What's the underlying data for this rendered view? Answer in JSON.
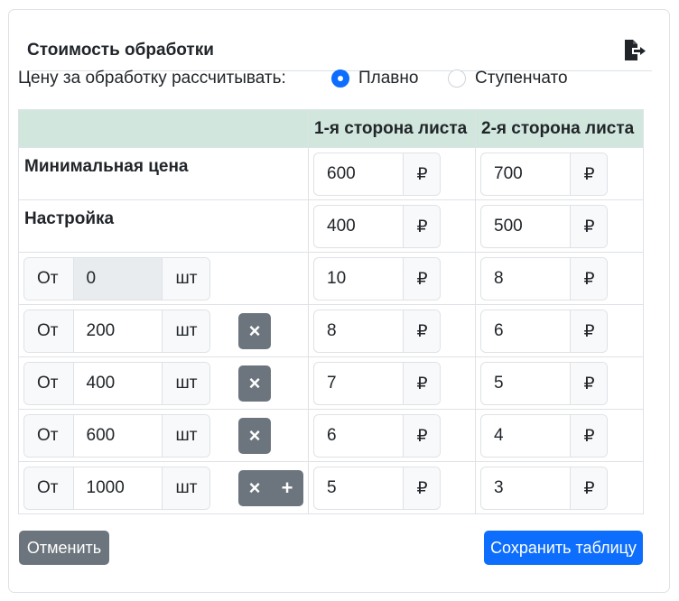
{
  "card": {
    "title": "Стоимость обработки",
    "export_icon": "file-export-icon"
  },
  "mode": {
    "label": "Цену за обработку рассчитывать:",
    "options": [
      {
        "label": "Плавно",
        "checked": true
      },
      {
        "label": "Ступенчато",
        "checked": false
      }
    ]
  },
  "table": {
    "headers": [
      "",
      "1-я сторона листа",
      "2-я сторона листа"
    ],
    "min_price": {
      "label": "Минимальная цена",
      "side1": "600",
      "side2": "700"
    },
    "setup": {
      "label": "Настройка",
      "side1": "400",
      "side2": "500"
    },
    "from_label": "От",
    "unit_label": "шт",
    "currency": "₽",
    "tiers": [
      {
        "from": "0",
        "side1": "10",
        "side2": "8"
      },
      {
        "from": "200",
        "side1": "8",
        "side2": "6"
      },
      {
        "from": "400",
        "side1": "7",
        "side2": "5"
      },
      {
        "from": "600",
        "side1": "6",
        "side2": "4"
      },
      {
        "from": "1000",
        "side1": "5",
        "side2": "3"
      }
    ],
    "remove_icon": "×",
    "add_icon": "+"
  },
  "buttons": {
    "cancel": "Отменить",
    "save": "Сохранить таблицу"
  },
  "colors": {
    "primary": "#0d6efd",
    "secondary": "#6c757d",
    "header_bg": "#d1e7dd"
  }
}
